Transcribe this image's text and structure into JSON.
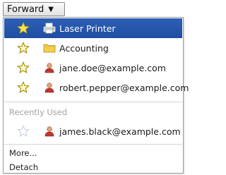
{
  "button": {
    "label": "Forward",
    "arrow": "▼"
  },
  "menu": {
    "items": [
      {
        "label": "Laser Printer",
        "star": "filled",
        "icon": "printer-icon",
        "selected": true
      },
      {
        "label": "Accounting",
        "star": "outline",
        "icon": "folder-icon",
        "selected": false
      },
      {
        "label": "jane.doe@example.com",
        "star": "outline",
        "icon": "person-icon",
        "selected": false
      },
      {
        "label": "robert.pepper@example.com",
        "star": "outline",
        "icon": "person-icon",
        "selected": false
      }
    ],
    "recent_header": "Recently Used",
    "recent_items": [
      {
        "label": "james.black@example.com",
        "star": "faded",
        "icon": "person-icon"
      }
    ],
    "more_label": "More...",
    "detach_label": "Detach"
  },
  "colors": {
    "selected_bg": "#2357ad",
    "star_yellow": "#f6e54a",
    "star_outline": "#b8a000",
    "folder": "#f2cf4e",
    "faded_text": "#a3a3a3"
  }
}
